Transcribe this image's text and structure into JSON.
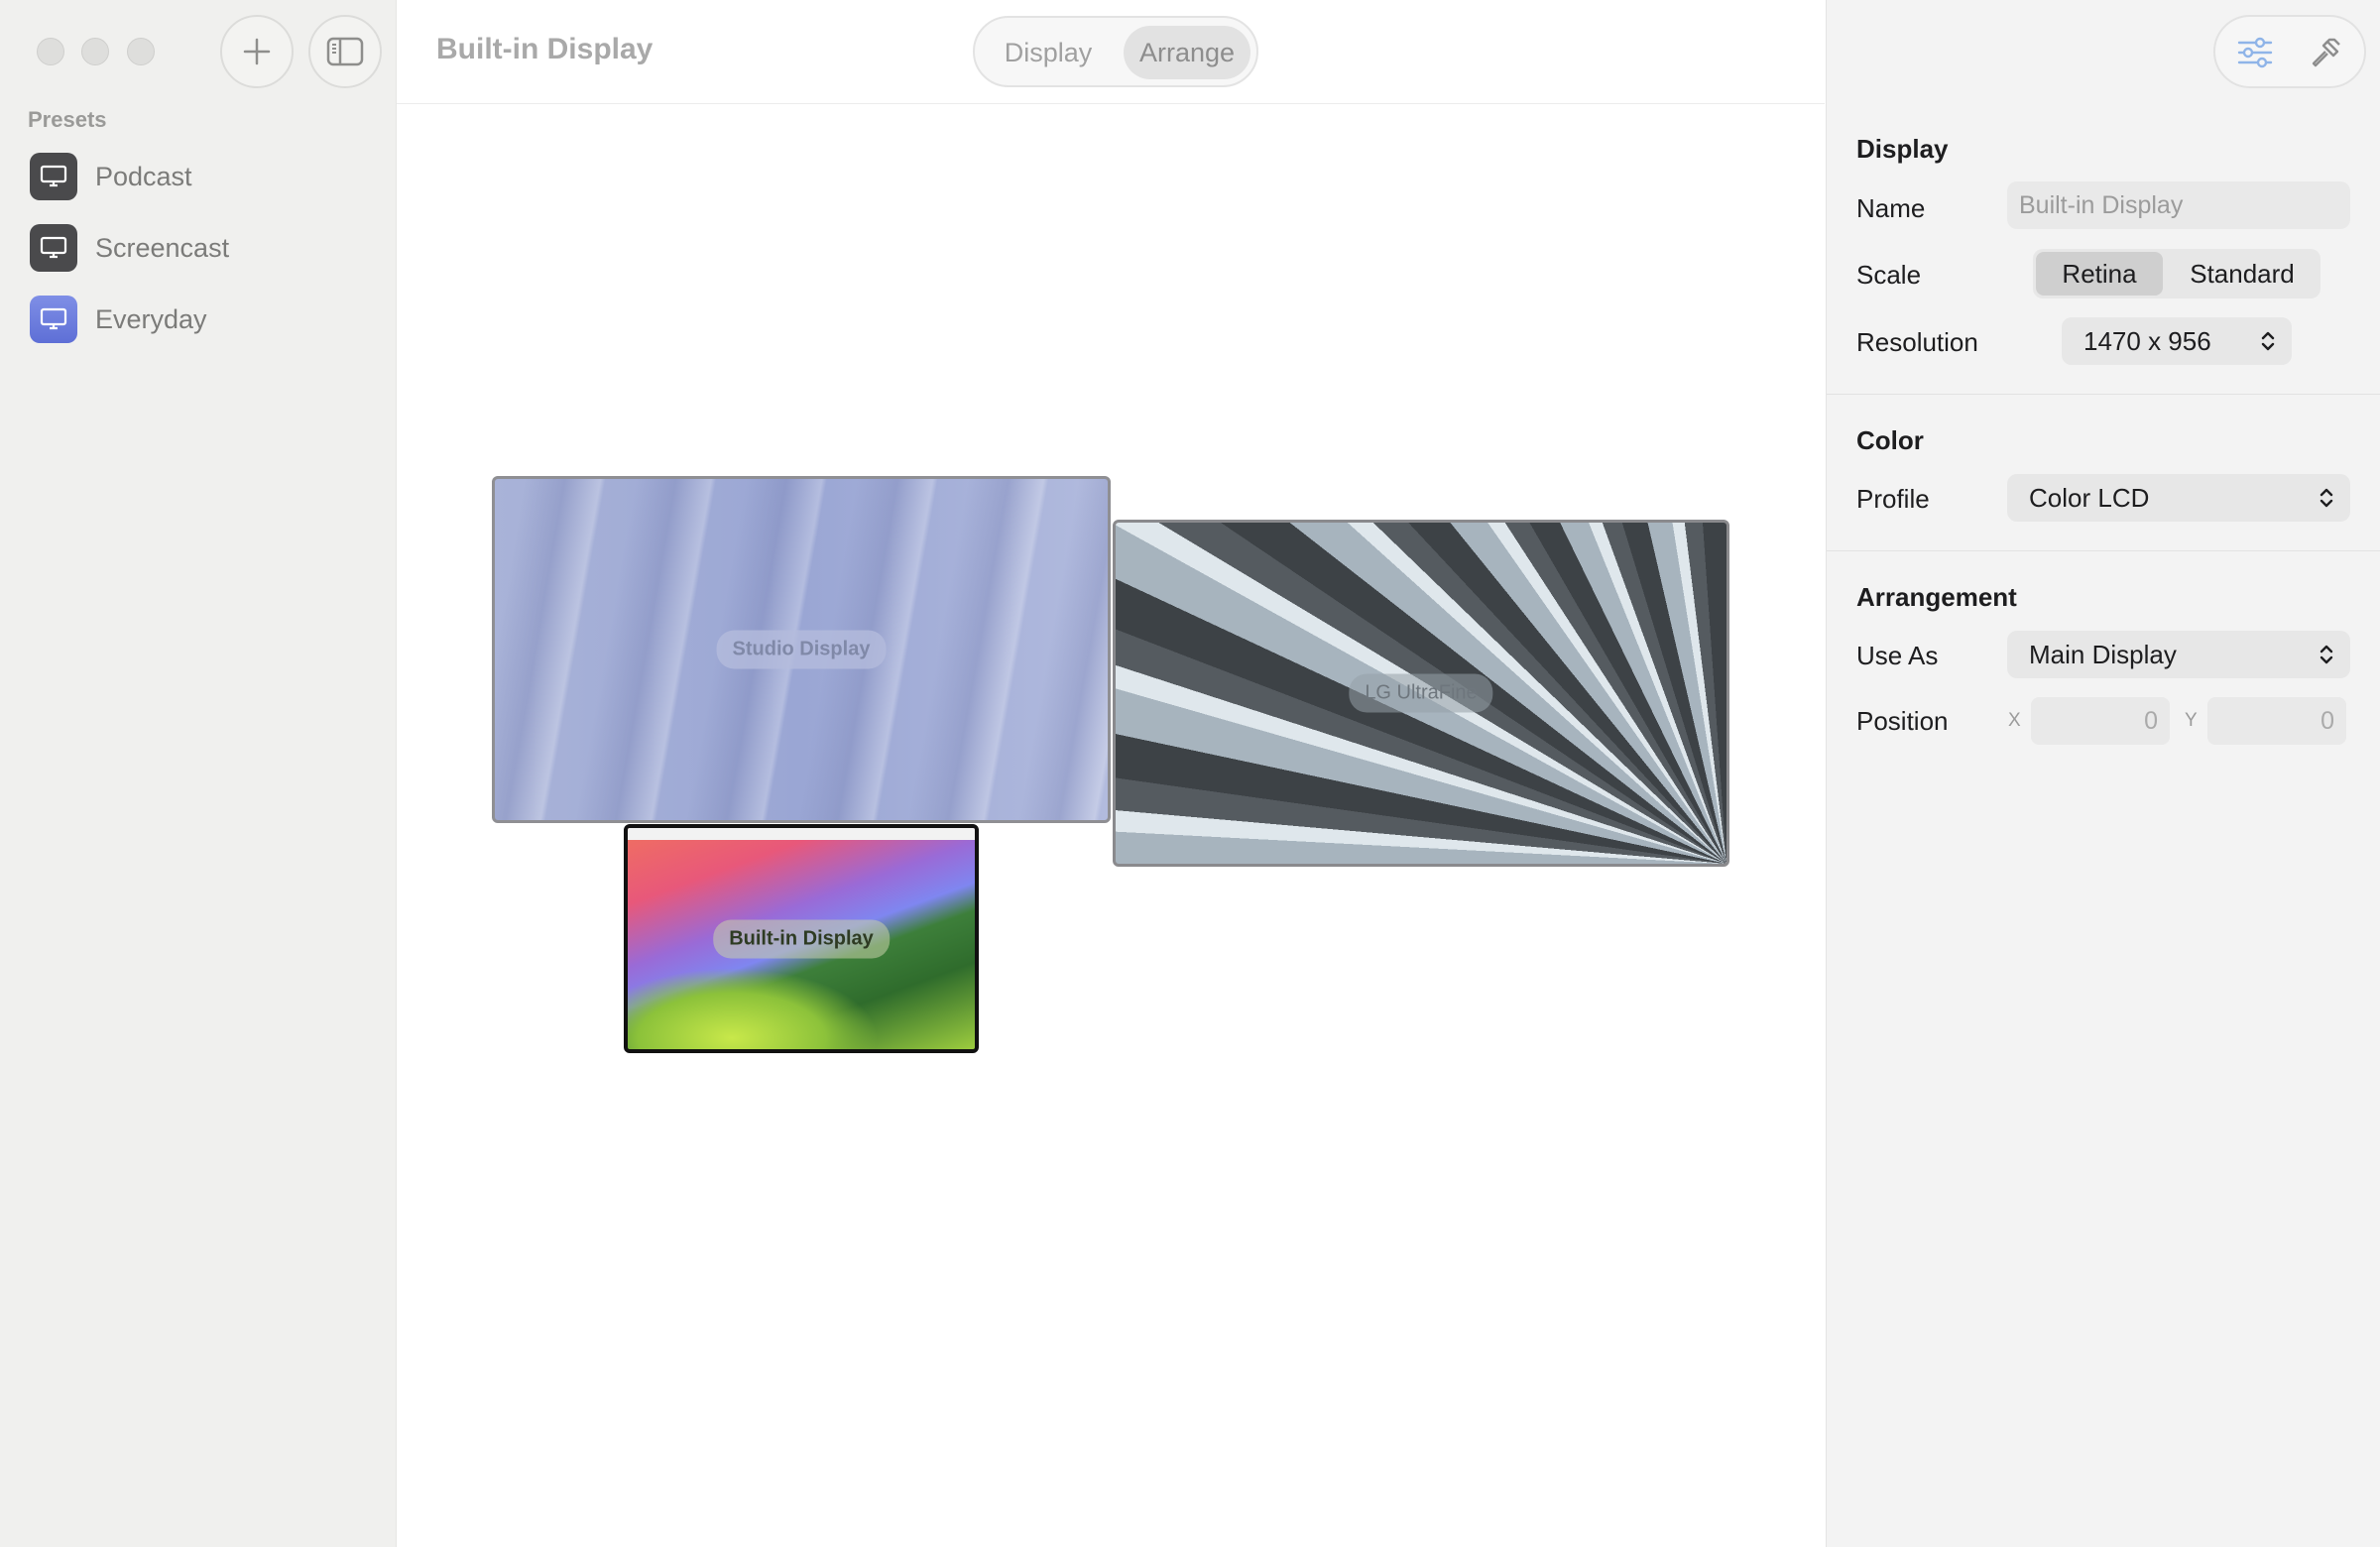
{
  "window": {
    "controls": [
      "close",
      "minimize",
      "zoom"
    ]
  },
  "sidebar": {
    "section_label": "Presets",
    "items": [
      {
        "label": "Podcast",
        "icon": "display-icon"
      },
      {
        "label": "Screencast",
        "icon": "display-icon"
      },
      {
        "label": "Everyday",
        "icon": "display-icon"
      }
    ]
  },
  "toolbar": {
    "title": "Built-in Display",
    "tabs": [
      {
        "label": "Display",
        "selected": false
      },
      {
        "label": "Arrange",
        "selected": true
      }
    ]
  },
  "arrangement": {
    "monitors": [
      {
        "label": "Studio Display"
      },
      {
        "label": "LG UltraFine"
      },
      {
        "label": "Built-in Display",
        "selected": true
      }
    ]
  },
  "inspector": {
    "display": {
      "title": "Display",
      "name_label": "Name",
      "name_placeholder": "Built-in Display",
      "scale_label": "Scale",
      "scale_options": [
        "Retina",
        "Standard"
      ],
      "scale_selected": "Retina",
      "resolution_label": "Resolution",
      "resolution_value": "1470 x 956"
    },
    "color": {
      "title": "Color",
      "profile_label": "Profile",
      "profile_value": "Color LCD"
    },
    "arrangement": {
      "title": "Arrangement",
      "use_as_label": "Use As",
      "use_as_value": "Main Display",
      "position_label": "Position",
      "x_label": "X",
      "x_value": "0",
      "y_label": "Y",
      "y_value": "0"
    }
  }
}
